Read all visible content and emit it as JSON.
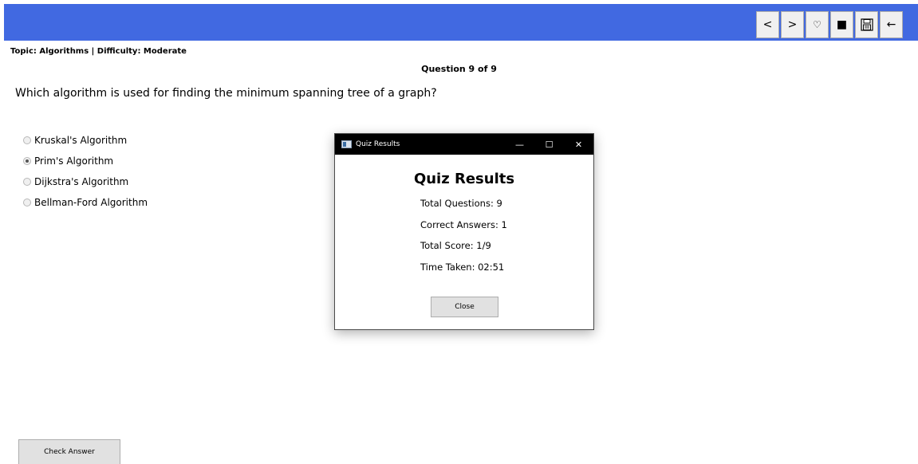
{
  "toolbar": {
    "buttons": [
      {
        "name": "previous",
        "label": "<"
      },
      {
        "name": "next",
        "label": ">"
      },
      {
        "name": "favorite",
        "label": "♡"
      },
      {
        "name": "stop",
        "label": "■"
      },
      {
        "name": "save",
        "label": ""
      },
      {
        "name": "back",
        "label": "←"
      }
    ]
  },
  "quiz": {
    "topic_line": "Topic: Algorithms | Difficulty: Moderate",
    "question_number": "Question 9 of 9",
    "question_text": "Which algorithm is used for finding the minimum spanning tree of a graph?",
    "options": [
      {
        "label": "Kruskal's Algorithm",
        "selected": false
      },
      {
        "label": "Prim's Algorithm",
        "selected": true
      },
      {
        "label": "Dijkstra's Algorithm",
        "selected": false
      },
      {
        "label": "Bellman-Ford Algorithm",
        "selected": false
      }
    ],
    "check_button_label": "Check Answer"
  },
  "dialog": {
    "window_title": "Quiz Results",
    "minimize_label": "—",
    "maximize_label": "☐",
    "close_label": "✕",
    "heading": "Quiz Results",
    "lines": [
      "Total Questions: 9",
      "Correct Answers: 1",
      "Total Score: 1/9",
      "Time Taken: 02:51"
    ],
    "close_button_label": "Close"
  },
  "colors": {
    "header_blue": "#4169e1",
    "dialog_titlebar": "#000000"
  }
}
